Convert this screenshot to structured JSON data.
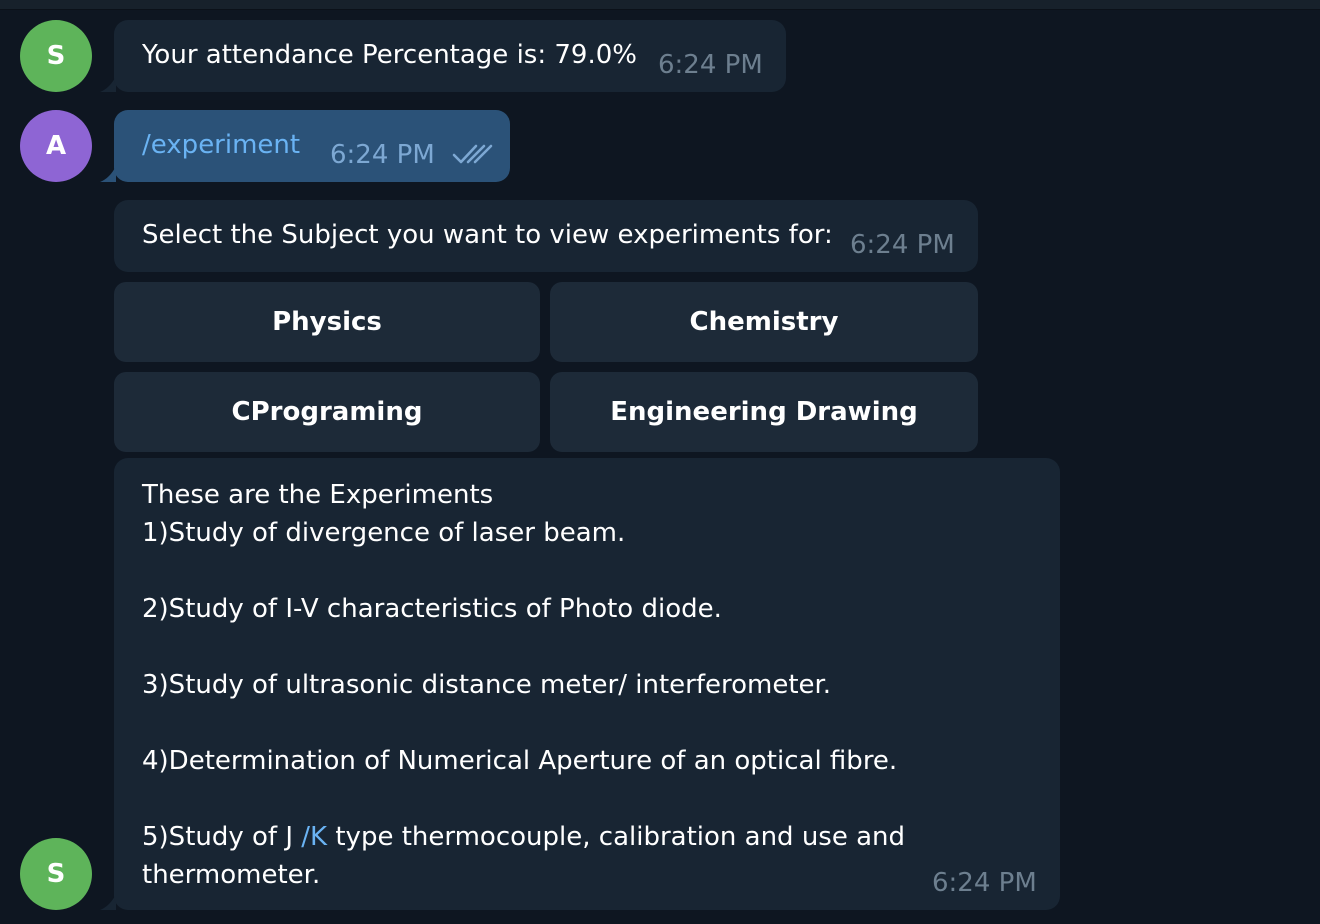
{
  "colors": {
    "background": "#0e1621",
    "bubble_in": "#182533",
    "bubble_out": "#2b5278",
    "button": "#1d2a38",
    "avatar_s": "#5eb45a",
    "avatar_a": "#8e65d4",
    "link": "#6ab3f3"
  },
  "messages": {
    "attendance": {
      "avatar": "S",
      "text": "Your attendance Percentage is: 79.0%",
      "time": "6:24 PM"
    },
    "command": {
      "avatar": "A",
      "text": "/experiment",
      "time": "6:24 PM",
      "status_icon": "double-check-icon"
    },
    "select": {
      "text": "Select the Subject you want to view experiments for:",
      "time": "6:24 PM"
    },
    "experiments": {
      "avatar": "S",
      "heading": "These are the Experiments",
      "item1": "1)Study of divergence of laser beam.",
      "item2": "2)Study of I-V characteristics of Photo diode.",
      "item3": "3)Study of ultrasonic distance meter/ interferometer.",
      "item4": "4)Determination of Numerical Aperture of an optical fibre.",
      "item5_prefix": "5)Study of J ",
      "item5_link": "/K",
      "item5_suffix": " type thermocouple, calibration and use and",
      "item5_line2": "thermometer.",
      "time": "6:24 PM"
    }
  },
  "keyboard": {
    "physics": "Physics",
    "chemistry": "Chemistry",
    "cprograming": "CPrograming",
    "engineering_drawing": "Engineering Drawing"
  }
}
